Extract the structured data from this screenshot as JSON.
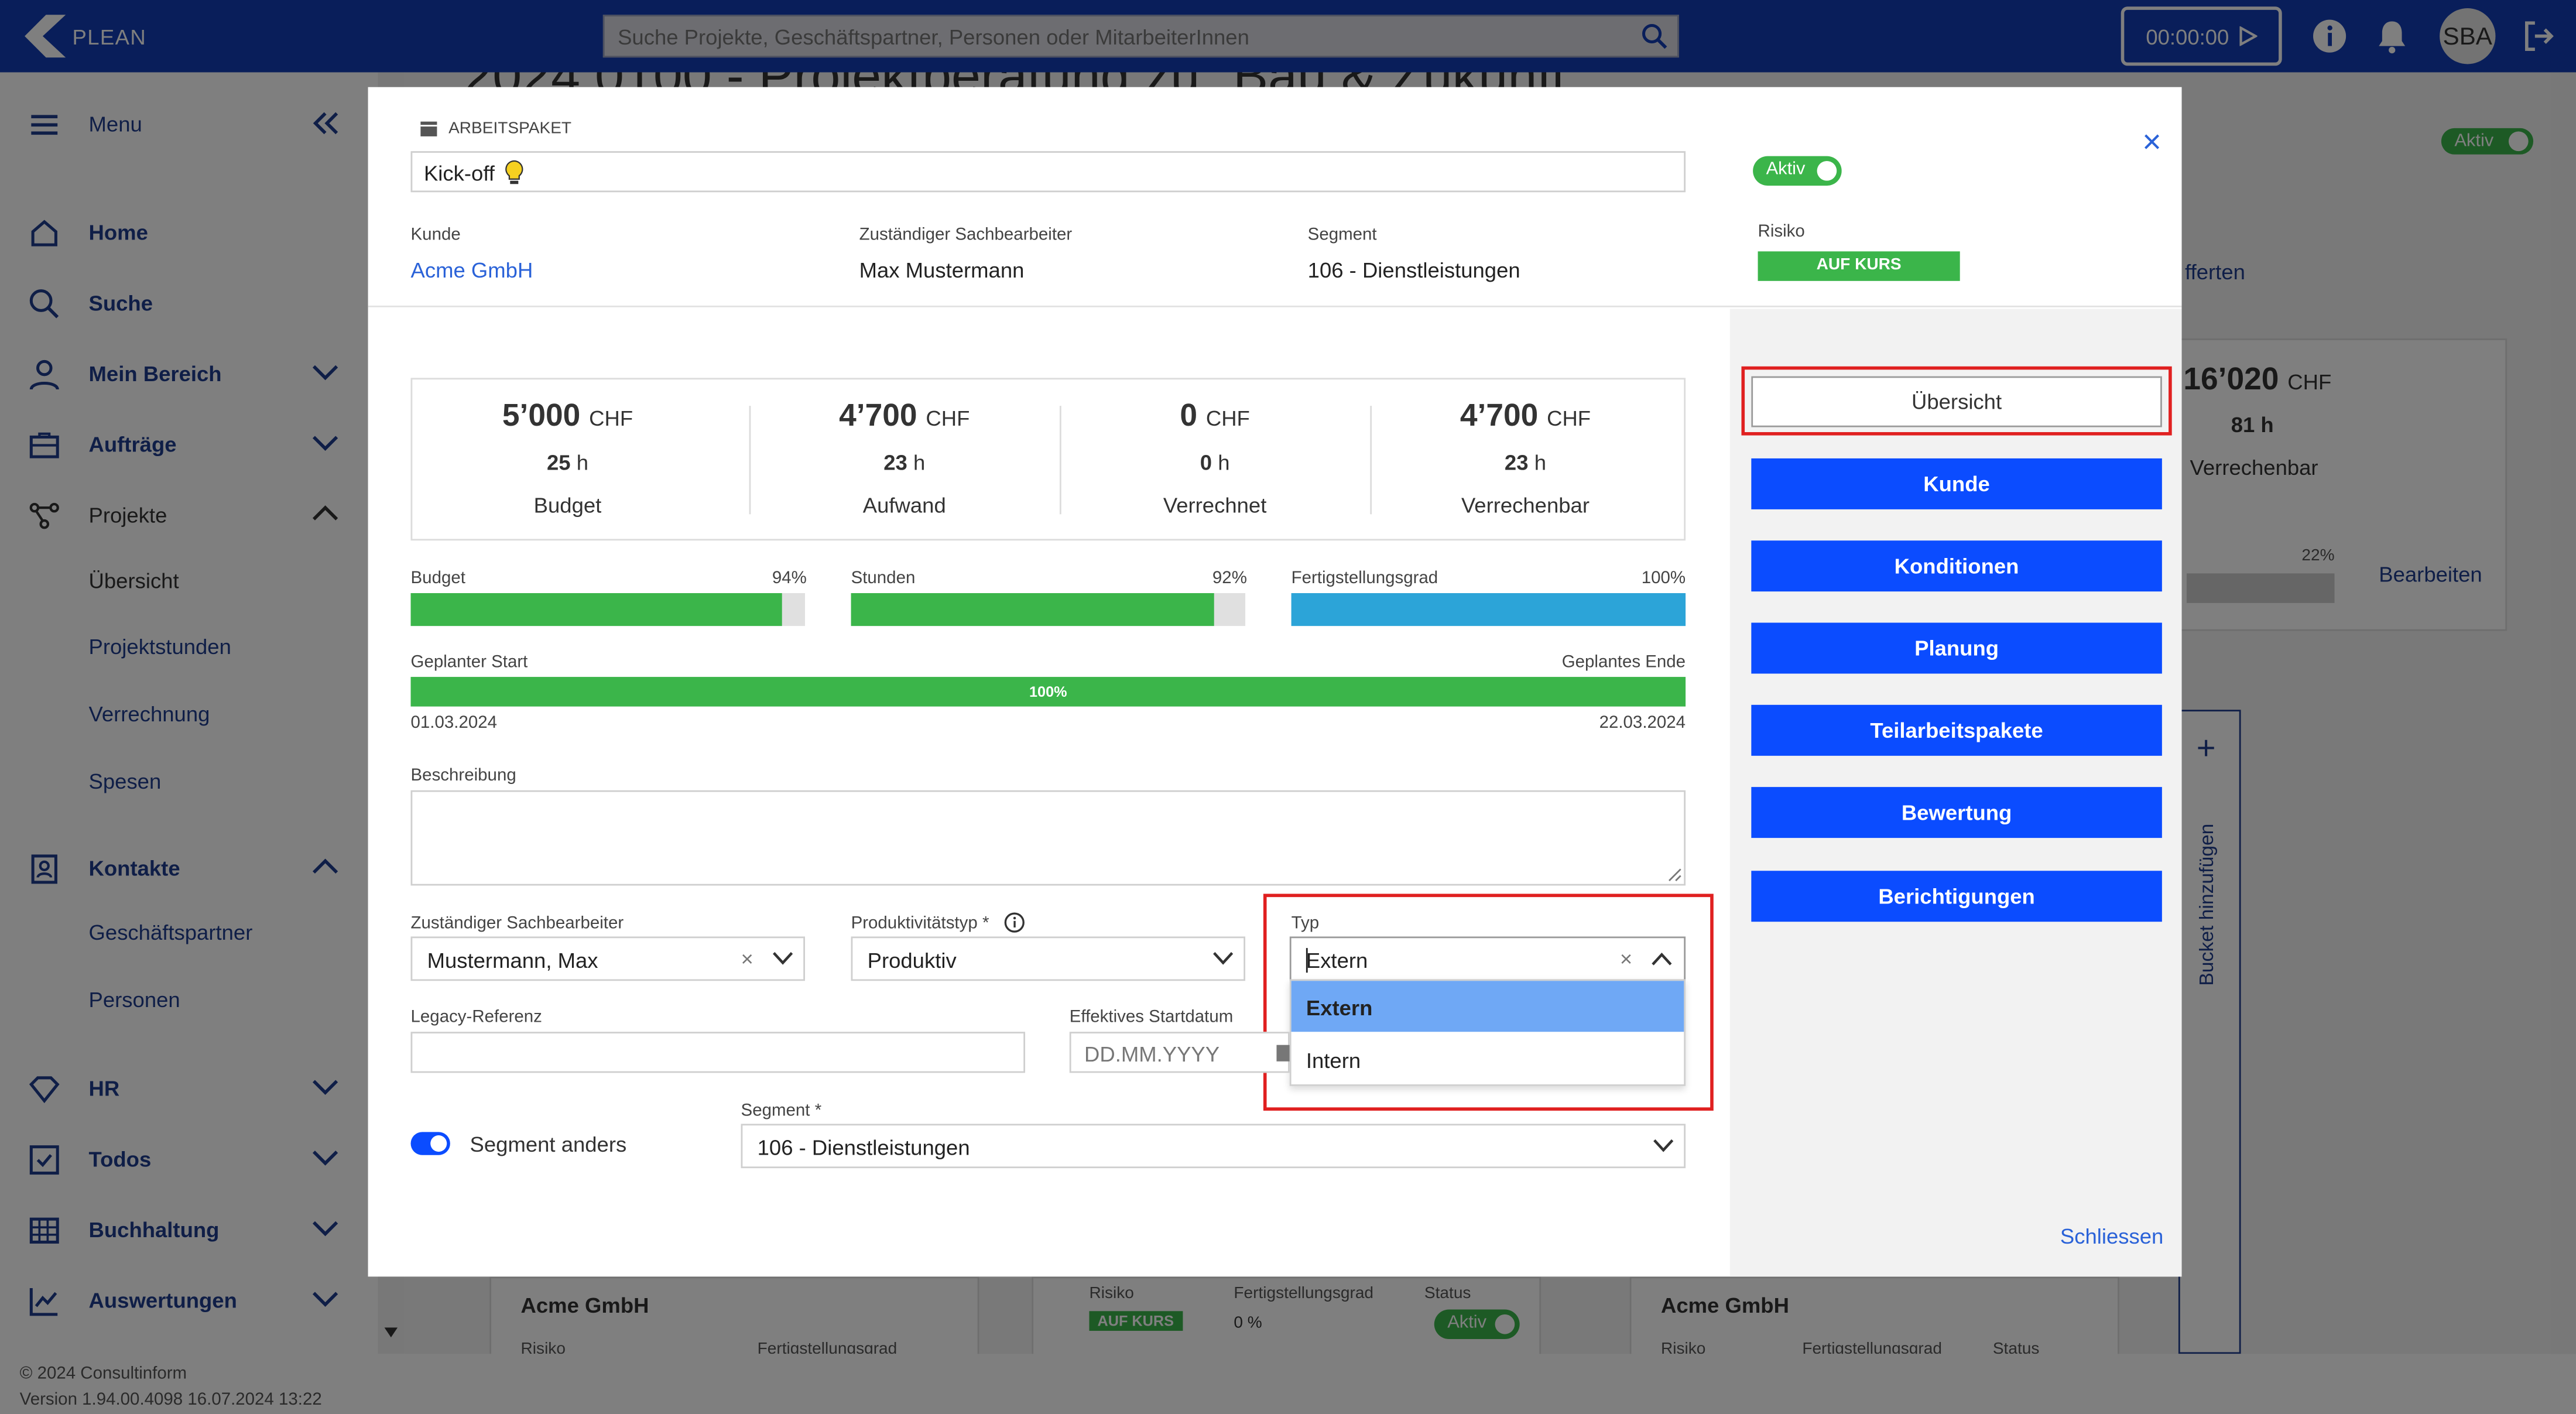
{
  "app": {
    "logo_text": "PLEAN"
  },
  "topbar": {
    "search_placeholder": "Suche Projekte, Geschäftspartner, Personen oder MitarbeiterInnen",
    "timer": "00:00:00",
    "avatar": "SBA"
  },
  "sidebar": {
    "menu_label": "Menu",
    "items": [
      {
        "label": "Home",
        "icon": "home-icon"
      },
      {
        "label": "Suche",
        "icon": "search-icon"
      },
      {
        "label": "Mein Bereich",
        "icon": "person-icon"
      },
      {
        "label": "Aufträge",
        "icon": "briefcase-icon"
      },
      {
        "label": "Projekte",
        "icon": "project-icon"
      },
      {
        "label": "Kontakte",
        "icon": "contacts-icon"
      },
      {
        "label": "HR",
        "icon": "diamond-icon"
      },
      {
        "label": "Todos",
        "icon": "checkbox-icon"
      },
      {
        "label": "Buchhaltung",
        "icon": "table-icon"
      },
      {
        "label": "Auswertungen",
        "icon": "chart-icon"
      }
    ],
    "projekte_sub": [
      "Übersicht",
      "Projektstunden",
      "Verrechnung",
      "Spesen"
    ],
    "kontakte_sub": [
      "Geschäftspartner",
      "Personen"
    ]
  },
  "footer": {
    "copyright": "© 2024 Consultinform",
    "version": "Version 1.94.00.4098 16.07.2024 13:22"
  },
  "page": {
    "title": "2024.0100 - Projektberatung zu \"Bau & Zukunft\"",
    "status_badge": "Aktiv",
    "tab_fragment": "fferten",
    "total_amount": "16’020",
    "total_currency": "CHF",
    "total_hours": "81 h",
    "total_label": "Verrechenbar",
    "percent": "22%",
    "edit_link": "Bearbeiten",
    "bucket_add": "Bucket hinzufügen",
    "cards": [
      {
        "title": "Acme GmbH",
        "risk_label": "Risiko",
        "progress_label": "Fertigstellungsgrad"
      },
      {
        "risk_label": "Risiko",
        "risk": "AUF KURS",
        "progress_label": "Fertigstellungsgrad",
        "progress": "0 %",
        "status_label": "Status",
        "status": "Aktiv"
      },
      {
        "title": "Acme GmbH",
        "risk_label": "Risiko",
        "progress_label": "Fertigstellungsgrad",
        "status_label": "Status"
      }
    ]
  },
  "modal": {
    "section_label": "ARBEITSPAKET",
    "name_value": "Kick-off",
    "status_toggle": "Aktiv",
    "close_symbol": "×",
    "customer_label": "Kunde",
    "customer_value": "Acme GmbH",
    "clerk_label": "Zuständiger Sachbearbeiter",
    "clerk_value": "Max Mustermann",
    "segment_label": "Segment",
    "segment_value": "106 - Dienstleistungen",
    "risk_label": "Risiko",
    "risk_value": "AUF KURS",
    "stats": [
      {
        "amount": "5’000",
        "currency": "CHF",
        "hours": "25",
        "unit": "h",
        "label": "Budget"
      },
      {
        "amount": "4’700",
        "currency": "CHF",
        "hours": "23",
        "unit": "h",
        "label": "Aufwand"
      },
      {
        "amount": "0",
        "currency": "CHF",
        "hours": "0",
        "unit": "h",
        "label": "Verrechnet"
      },
      {
        "amount": "4’700",
        "currency": "CHF",
        "hours": "23",
        "unit": "h",
        "label": "Verrechenbar"
      }
    ],
    "bars": [
      {
        "label": "Budget",
        "percent_text": "94%",
        "fraction": 0.94,
        "color": "#3bb54a"
      },
      {
        "label": "Stunden",
        "percent_text": "92%",
        "fraction": 0.92,
        "color": "#3bb54a"
      },
      {
        "label": "Fertigstellungsgrad",
        "percent_text": "100%",
        "fraction": 1.0,
        "color": "#2ca4d8"
      }
    ],
    "timeline": {
      "start_label": "Geplanter Start",
      "end_label": "Geplantes Ende",
      "percent_text": "100%",
      "fraction": 1.0,
      "start_date": "01.03.2024",
      "end_date": "22.03.2024"
    },
    "description_label": "Beschreibung",
    "description_value": "",
    "form": {
      "clerk_label": "Zuständiger Sachbearbeiter",
      "clerk_value": "Mustermann, Max",
      "productivity_label": "Produktivitätstyp",
      "required_mark": "*",
      "productivity_value": "Produktiv",
      "type_label": "Typ",
      "type_value": "Extern",
      "type_options": [
        "Extern",
        "Intern"
      ],
      "legacy_label": "Legacy-Referenz",
      "legacy_value": "",
      "start_label": "Effektives Startdatum",
      "start_placeholder": "DD.MM.YYYY",
      "segment_toggle_label": "Segment anders",
      "segment_select_label": "Segment",
      "segment_select_value": "106 - Dienstleistungen"
    },
    "nav_buttons": [
      "Übersicht",
      "Kunde",
      "Konditionen",
      "Planung",
      "Teilarbeitspakete",
      "Bewertung",
      "Berichtigungen"
    ],
    "close_link": "Schliessen"
  },
  "colors": {
    "topbar": "#123cb4",
    "accent_blue": "#0b4cff",
    "green": "#3bb54a",
    "highlight": "#e02020",
    "dropdown_selected": "#6fa8f5"
  }
}
